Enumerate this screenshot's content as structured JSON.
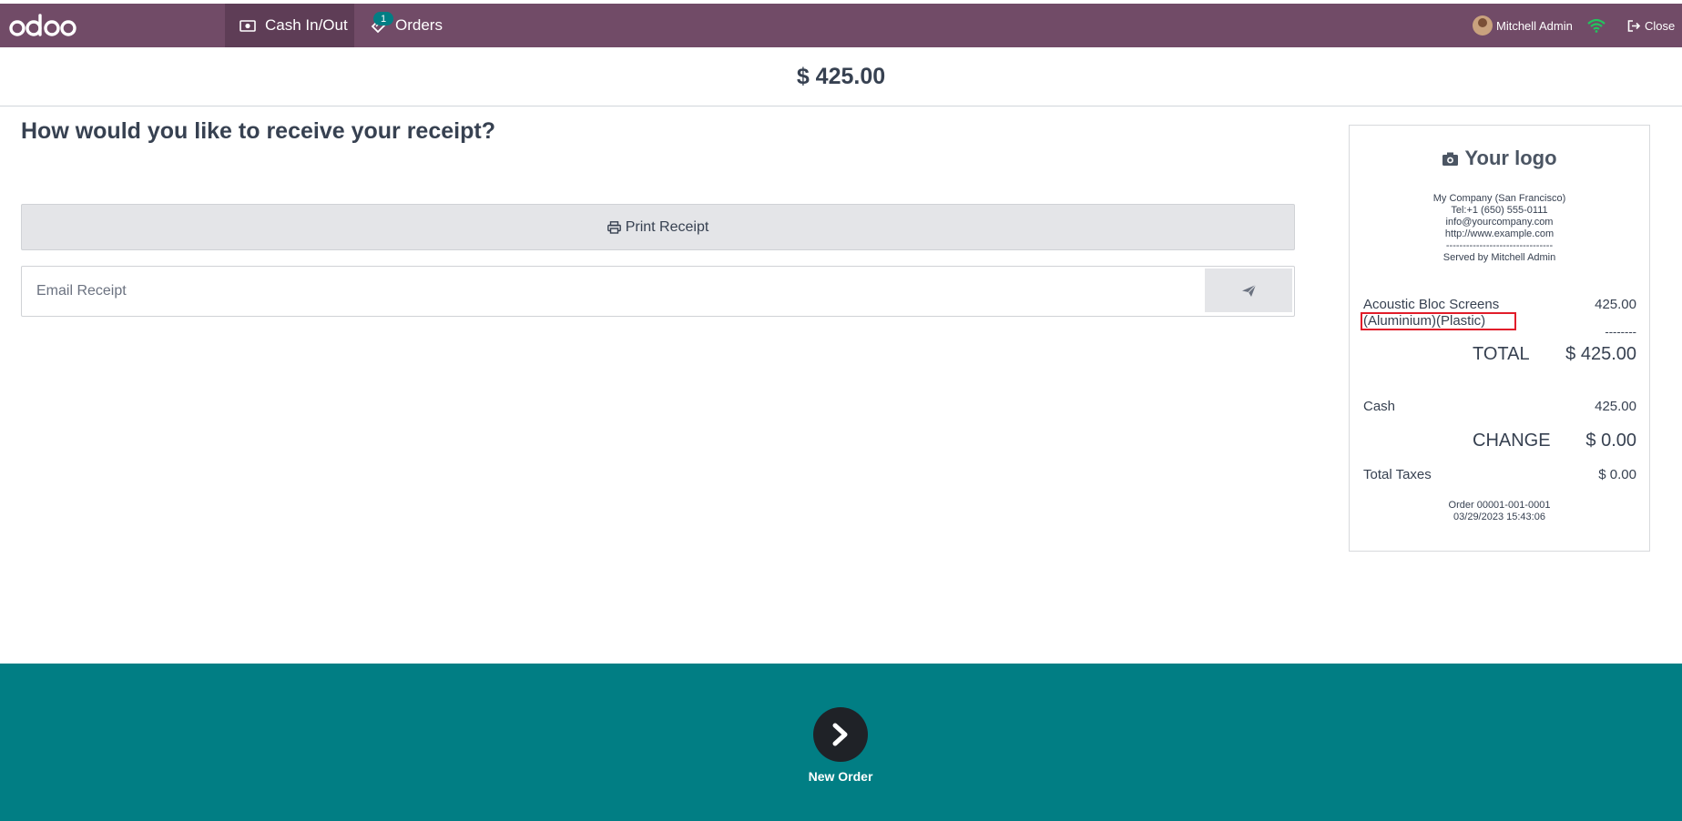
{
  "topbar": {
    "brand": "odoo",
    "cash_label": "Cash In/Out",
    "orders_label": "Orders",
    "orders_badge": "1",
    "user_name": "Mitchell Admin",
    "close_label": "Close",
    "bar_color": "#714B67"
  },
  "payment": {
    "amount": "$ 425.00",
    "question": "How would you like to receive your receipt?",
    "print_label": "Print Receipt",
    "email_placeholder": "Email Receipt"
  },
  "receipt": {
    "logo_text": "Your logo",
    "company_lines": [
      "My Company (San Francisco)",
      "Tel:+1 (650) 555-0111",
      "info@yourcompany.com",
      "http://www.example.com",
      "--------------------------------",
      "Served by Mitchell Admin"
    ],
    "line_name": "Acoustic Bloc Screens",
    "line_attrs": "(Aluminium)(Plastic)",
    "line_price": "425.00",
    "dashes": "--------",
    "total_label": "TOTAL",
    "total_value": "$ 425.00",
    "cash_label": "Cash",
    "cash_value": "425.00",
    "change_label": "CHANGE",
    "change_value": "$ 0.00",
    "taxes_label": "Total Taxes",
    "taxes_value": "$ 0.00",
    "order_ref": "Order 00001-001-0001",
    "order_date": "03/29/2023 15:43:06"
  },
  "footer": {
    "new_order_label": "New Order",
    "bg_color": "#017e84"
  }
}
